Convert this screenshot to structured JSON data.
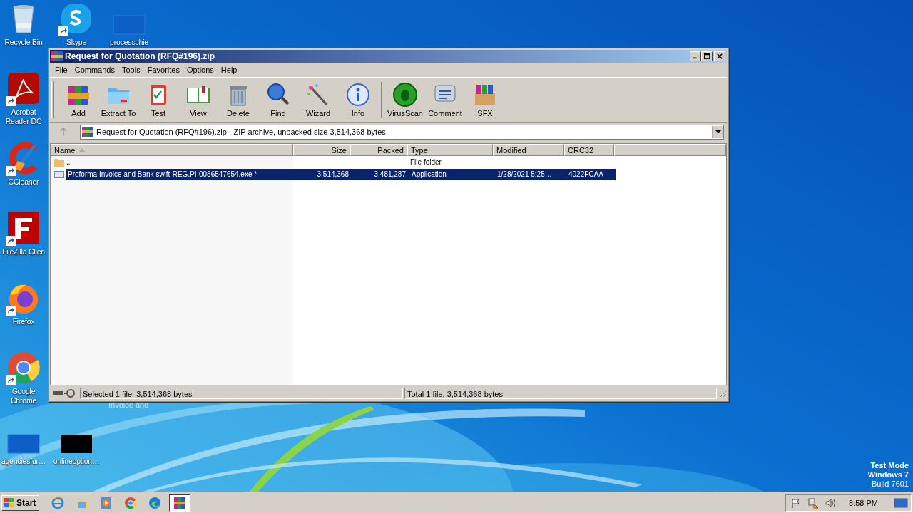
{
  "desktop": {
    "icons": [
      {
        "label": "Recycle Bin",
        "kind": "recycle",
        "shortcut": false
      },
      {
        "label": "Skype",
        "kind": "skype",
        "shortcut": true
      },
      {
        "label": "processchie",
        "kind": "blank",
        "shortcut": false
      },
      {
        "label": "Acrobat Reader DC",
        "kind": "acrobat",
        "shortcut": true
      },
      {
        "label": "CCleaner",
        "kind": "ccleaner",
        "shortcut": true
      },
      {
        "label": "FileZilla Clien",
        "kind": "filezilla",
        "shortcut": true
      },
      {
        "label": "Firefox",
        "kind": "firefox",
        "shortcut": true
      },
      {
        "label": "Google Chrome",
        "kind": "chrome",
        "shortcut": true
      },
      {
        "label": "agenciesfur…",
        "kind": "blank",
        "shortcut": false
      },
      {
        "label": "onlineoption…",
        "kind": "black",
        "shortcut": false
      }
    ],
    "hidden_label": "Invoice and",
    "system_text": [
      "Test Mode",
      "Windows 7",
      "Build 7601"
    ]
  },
  "window": {
    "title": "Request for Quotation (RFQ#196).zip",
    "menu": [
      "File",
      "Commands",
      "Tools",
      "Favorites",
      "Options",
      "Help"
    ],
    "toolbar": [
      {
        "label": "Add",
        "kind": "add"
      },
      {
        "label": "Extract To",
        "kind": "extract"
      },
      {
        "label": "Test",
        "kind": "test"
      },
      {
        "label": "View",
        "kind": "view"
      },
      {
        "label": "Delete",
        "kind": "delete"
      },
      {
        "label": "Find",
        "kind": "find"
      },
      {
        "label": "Wizard",
        "kind": "wizard"
      },
      {
        "label": "Info",
        "kind": "info"
      },
      {
        "label": "VirusScan",
        "kind": "virus",
        "separator_before": true
      },
      {
        "label": "Comment",
        "kind": "comment"
      },
      {
        "label": "SFX",
        "kind": "sfx"
      }
    ],
    "address": "Request for Quotation (RFQ#196).zip - ZIP archive, unpacked size 3,514,368 bytes",
    "columns": [
      "Name",
      "Size",
      "Packed",
      "Type",
      "Modified",
      "CRC32"
    ],
    "rows": [
      {
        "kind": "folder",
        "name": "..",
        "type": "File folder",
        "selected": false
      },
      {
        "kind": "exe",
        "name": "Proforma Invoice and Bank swift-REG.PI-0086547654.exe *",
        "size": "3,514,368",
        "packed": "3,481,287",
        "type": "Application",
        "modified": "1/28/2021 5:25…",
        "crc": "4022FCAA",
        "selected": true
      }
    ],
    "status_left": "Selected 1 file, 3,514,368 bytes",
    "status_right": "Total 1 file, 3,514,368 bytes"
  },
  "taskbar": {
    "start": "Start",
    "apps": [
      {
        "kind": "ie",
        "active": false
      },
      {
        "kind": "explorer",
        "active": false
      },
      {
        "kind": "media",
        "active": false
      },
      {
        "kind": "chrome",
        "active": false
      },
      {
        "kind": "edge",
        "active": false
      },
      {
        "kind": "winrar",
        "active": true
      }
    ],
    "clock": "8:58 PM"
  }
}
